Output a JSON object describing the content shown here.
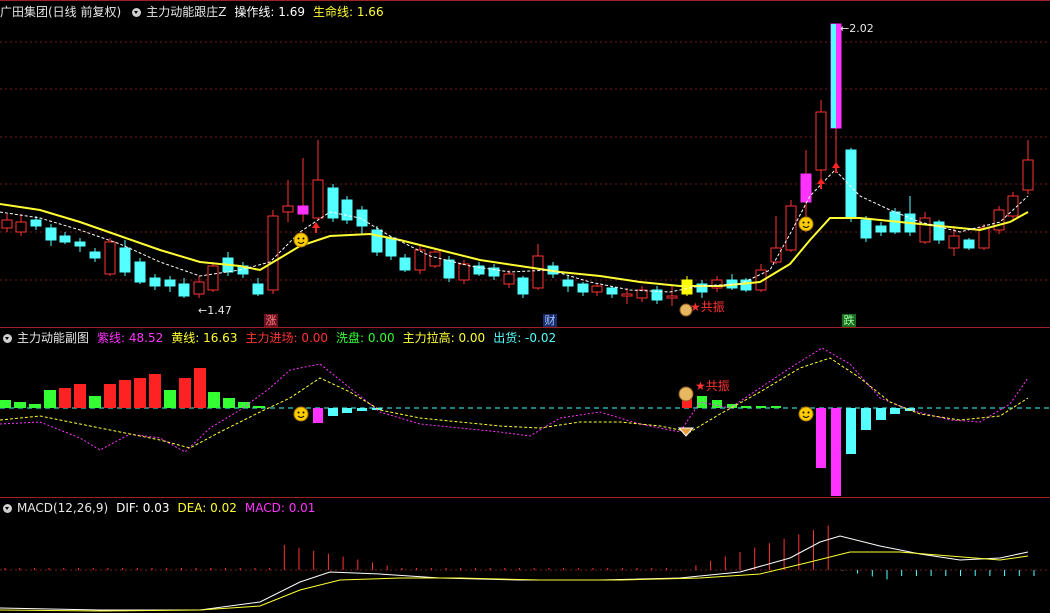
{
  "main_panel": {
    "stock_name": "广田集团(日线 前复权)",
    "indicator_name": "主力动能跟庄Z",
    "items": [
      {
        "label": "操作线: ",
        "value": "1.69",
        "color": "#ffffff"
      },
      {
        "label": "生命线: ",
        "value": "1.66",
        "color": "#ffff33"
      }
    ],
    "high_label": "2.02",
    "low_label": "1.47",
    "signal_label": "共振",
    "markers": [
      "涨",
      "财",
      "跌"
    ],
    "colors": {
      "up": "#ff3333",
      "down": "#54ffff",
      "life_line": "#ffff33",
      "op_line": "#ffffff",
      "highlight": "#ff33ff"
    }
  },
  "sub_panel": {
    "indicator_name": "主力动能副图",
    "items": [
      {
        "label": "紫线: ",
        "value": "48.52",
        "color": "#ff33ff"
      },
      {
        "label": "黄线: ",
        "value": "16.63",
        "color": "#ffff33"
      },
      {
        "label": "主力进场: ",
        "value": "0.00",
        "color": "#ff3333"
      },
      {
        "label": "洗盘: ",
        "value": "0.00",
        "color": "#33ff33"
      },
      {
        "label": "主力拉高: ",
        "value": "0.00",
        "color": "#ffff33"
      },
      {
        "label": "出货: ",
        "value": "-0.02",
        "color": "#54ffff"
      }
    ],
    "signal_label": "共振"
  },
  "macd_panel": {
    "indicator_name": "MACD(12,26,9)",
    "items": [
      {
        "label": "DIF: ",
        "value": "0.03",
        "color": "#ffffff"
      },
      {
        "label": "DEA: ",
        "value": "0.02",
        "color": "#ffff33"
      },
      {
        "label": "MACD: ",
        "value": "0.01",
        "color": "#ff33ff"
      }
    ]
  }
}
